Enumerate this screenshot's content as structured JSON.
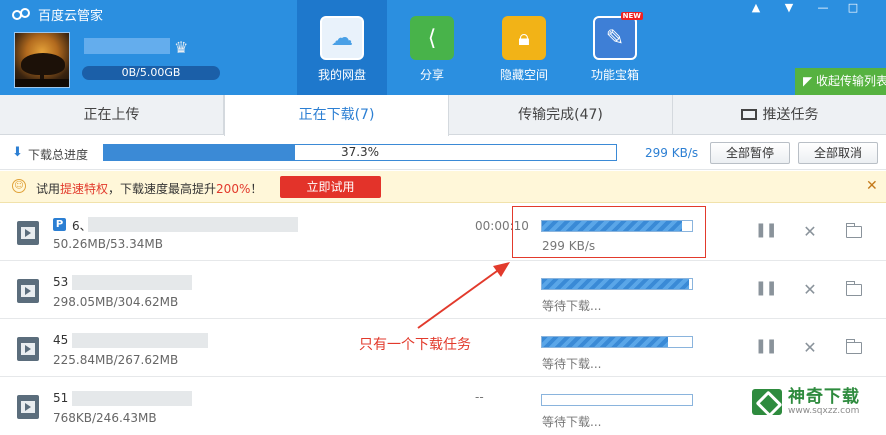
{
  "app": {
    "title": "百度云管家"
  },
  "account": {
    "quota": "0B/5.00GB"
  },
  "nav": [
    {
      "label": "我的网盘",
      "icon": "cloud-icon",
      "active": true
    },
    {
      "label": "分享",
      "icon": "share-icon"
    },
    {
      "label": "隐藏空间",
      "icon": "lock-icon"
    },
    {
      "label": "功能宝箱",
      "icon": "toolbox-icon",
      "badge": "NEW"
    }
  ],
  "collapse_label": "收起传输列表",
  "tabs": [
    {
      "label": "正在上传"
    },
    {
      "label": "正在下载(7)",
      "active": true
    },
    {
      "label": "传输完成(47)"
    },
    {
      "label": "推送任务",
      "icon": "push-icon"
    }
  ],
  "summary": {
    "label": "下载总进度",
    "percent_text": "37.3%",
    "progress": 0.373,
    "speed": "299 KB/s",
    "pause_all": "全部暂停",
    "cancel_all": "全部取消"
  },
  "promo": {
    "text_pre": "试用",
    "text_hl1": "提速特权",
    "text_mid": "，下载速度最高提升",
    "text_hl2": "200%",
    "text_post": "！",
    "button": "立即试用"
  },
  "downloads": [
    {
      "name": "6、",
      "size": "50.26MB/53.34MB",
      "time": "00:00:10",
      "status": "299 KB/s",
      "progress": 0.93
    },
    {
      "name": "53",
      "size": "298.05MB/304.62MB",
      "time": "",
      "status": "等待下载...",
      "progress": 0.98
    },
    {
      "name": "45",
      "size": "225.84MB/267.62MB",
      "time": "",
      "status": "等待下载...",
      "progress": 0.84
    },
    {
      "name": "51",
      "size": "768KB/246.43MB",
      "time": "--",
      "status": "等待下载...",
      "progress": 0.003
    }
  ],
  "annotation": "只有一个下载任务",
  "watermark": {
    "title": "神奇下载",
    "url": "www.sqxzz.com"
  },
  "colors": {
    "header": "#2b8fe0",
    "accent": "#2c7fd3",
    "alert": "#e23a2c",
    "green": "#56b240"
  }
}
